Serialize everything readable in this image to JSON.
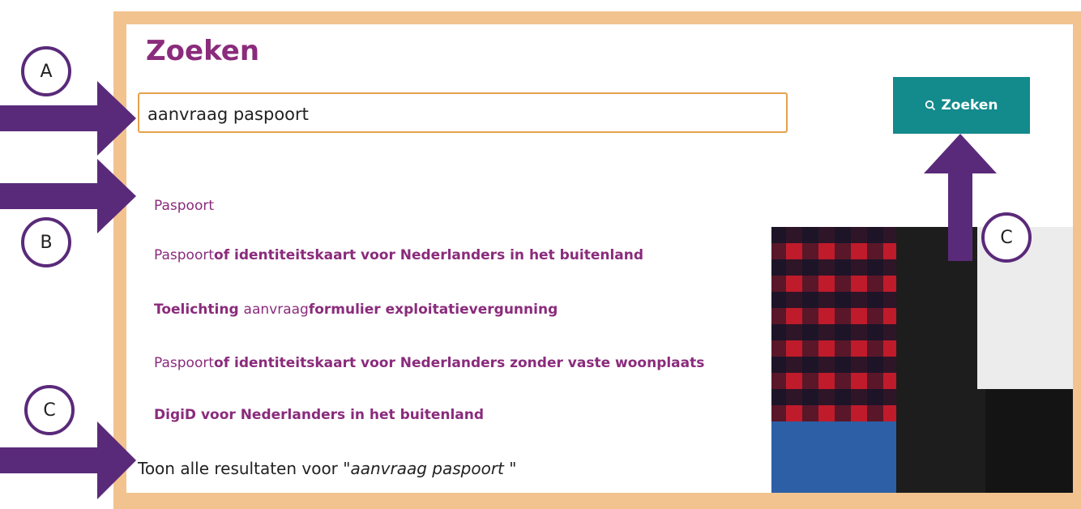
{
  "page": {
    "title": "Zoeken"
  },
  "search": {
    "value": "aanvraag paspoort",
    "button_label": "Zoeken",
    "button_icon": "search-icon"
  },
  "suggestions": [
    {
      "parts": [
        {
          "text": "Paspoort",
          "bold": false
        }
      ]
    },
    {
      "parts": [
        {
          "text": "Paspoort",
          "bold": false
        },
        {
          "text": "of identiteitskaart voor Nederlanders in het buitenland",
          "bold": true
        }
      ]
    },
    {
      "parts": [
        {
          "text": "Toelichting ",
          "bold": true
        },
        {
          "text": "aanvraag",
          "bold": false
        },
        {
          "text": "formulier exploitatievergunning",
          "bold": true
        }
      ]
    },
    {
      "parts": [
        {
          "text": "Paspoort",
          "bold": false
        },
        {
          "text": "of identiteitskaart voor Nederlanders zonder vaste woonplaats",
          "bold": true
        }
      ]
    },
    {
      "parts": [
        {
          "text": "DigiD voor Nederlanders in het buitenland",
          "bold": true
        }
      ]
    }
  ],
  "show_all": {
    "prefix": "Toon alle resultaten voor \"",
    "query": "aanvraag paspoort ",
    "suffix": "\""
  },
  "annotations": {
    "a": "A",
    "b": "B",
    "c_top": "C",
    "c_bottom": "C"
  },
  "colors": {
    "brand": "#8a2b7c",
    "accent": "#138a8c",
    "frame": "#f2c38f",
    "arrow": "#5a2a7a"
  }
}
